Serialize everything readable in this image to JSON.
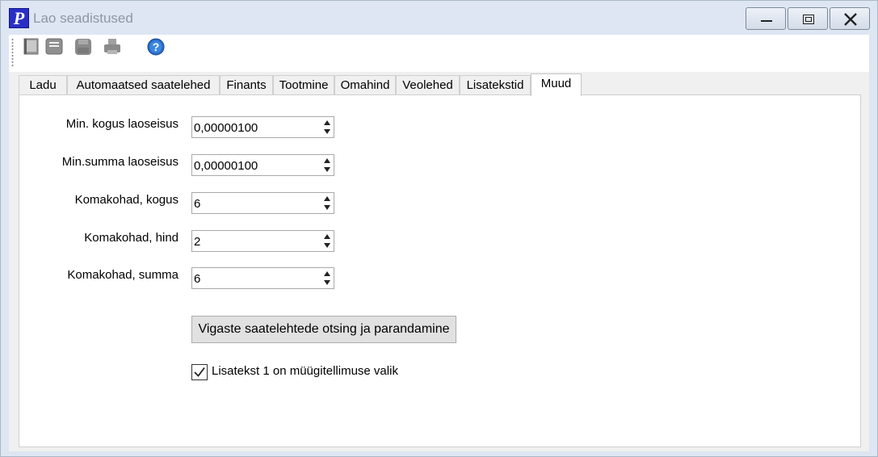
{
  "window": {
    "title": "Lao seadistused",
    "app_icon_letter": "P"
  },
  "toolbar": {
    "icons": [
      "new-document-icon",
      "form-icon",
      "save-icon",
      "print-icon",
      "help-icon"
    ]
  },
  "tabs": [
    {
      "label": "Ladu",
      "active": false
    },
    {
      "label": "Automaatsed saatelehed",
      "active": false
    },
    {
      "label": "Finants",
      "active": false
    },
    {
      "label": "Tootmine",
      "active": false
    },
    {
      "label": "Omahind",
      "active": false
    },
    {
      "label": "Veolehed",
      "active": false
    },
    {
      "label": "Lisatekstid",
      "active": false
    },
    {
      "label": "Muud",
      "active": true
    }
  ],
  "fields": [
    {
      "label": "Min. kogus laoseisus",
      "value": "0,00000100"
    },
    {
      "label": "Min.summa laoseisus",
      "value": "0,00000100"
    },
    {
      "label": "Komakohad, kogus",
      "value": "6"
    },
    {
      "label": "Komakohad, hind",
      "value": "2"
    },
    {
      "label": "Komakohad, summa",
      "value": "6"
    }
  ],
  "action_button": {
    "label": "Vigaste saatelehtede otsing ja parandamine"
  },
  "checkbox": {
    "label": "Lisatekst 1 on müügitellimuse valik",
    "checked": true
  }
}
